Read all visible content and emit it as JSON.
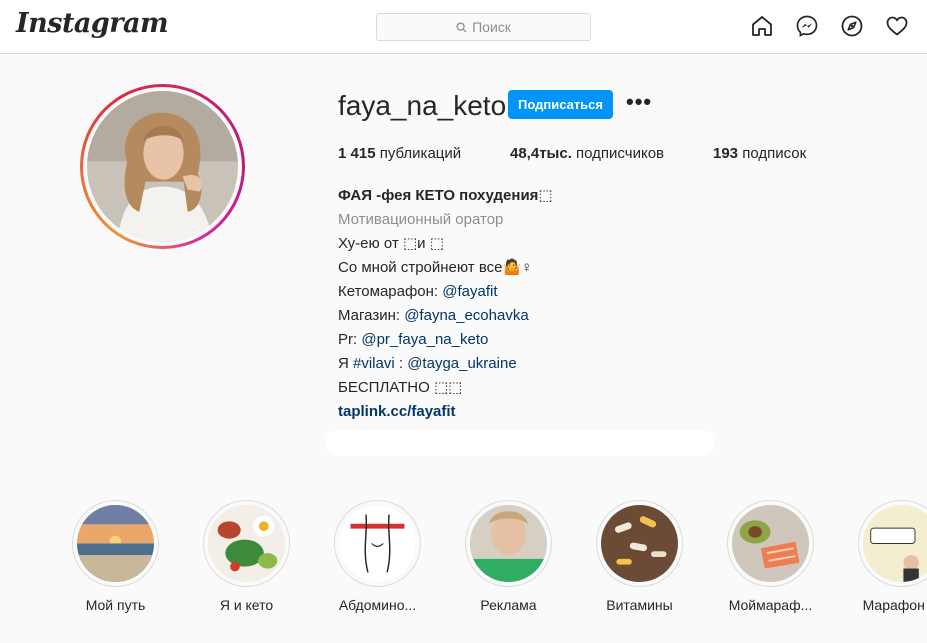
{
  "header": {
    "logo": "Instagram",
    "search_placeholder": "Поиск",
    "icons": [
      "home-icon",
      "messenger-icon",
      "explore-icon",
      "heart-icon"
    ]
  },
  "profile": {
    "username": "faya_na_keto",
    "follow_label": "Подписаться",
    "more_label": "•••",
    "stats": {
      "posts_count": "1 415",
      "posts_label": " публикаций",
      "followers_count": "48,4тыс.",
      "followers_label": " подписчиков",
      "following_count": "193",
      "following_label": " подписок"
    },
    "bio": {
      "full_name": "ФАЯ -фея КЕТО похудения⬚",
      "category": "Мотивационный оратор",
      "line1": "Ху-ею от ⬚и ⬚",
      "line2": "Со мной стройнеют все🤷♀",
      "line3_prefix": "Кетомарафон: ",
      "line3_link": "@fayafit",
      "line4_prefix": "Магазин: ",
      "line4_link": "@fayna_ecohavka",
      "line5_prefix": "Pr: ",
      "line5_link": "@pr_faya_na_keto",
      "line6_prefix": "Я ",
      "line6_link1": "#vilavi",
      "line6_sep": " : ",
      "line6_link2": "@tayga_ukraine",
      "line7": "БЕСПЛАТНО ⬚⬚",
      "website": "taplink.cc/fayafit"
    }
  },
  "highlights": [
    {
      "label": "Мой путь"
    },
    {
      "label": "Я и кето"
    },
    {
      "label": "Абдомино..."
    },
    {
      "label": "Реклама"
    },
    {
      "label": "Витамины"
    },
    {
      "label": "Моймараф..."
    },
    {
      "label": "Марафон ..."
    }
  ],
  "colors": {
    "accent": "#0095f6",
    "link": "#00376b",
    "muted": "#8e8e8e",
    "border": "#dbdbdb"
  }
}
